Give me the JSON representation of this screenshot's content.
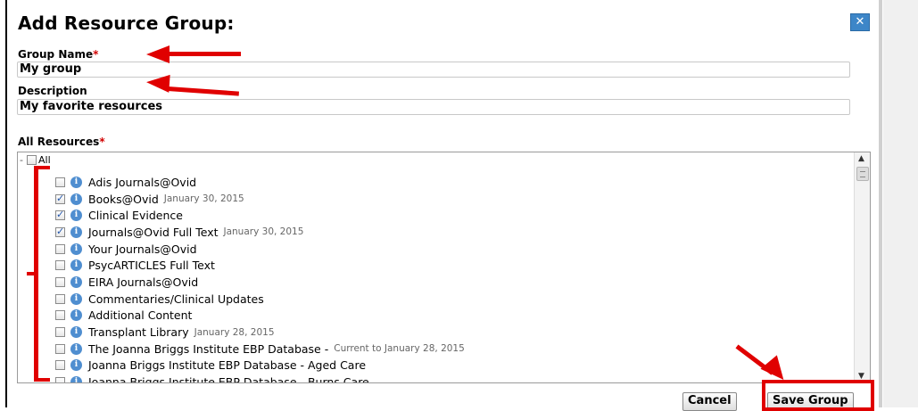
{
  "dialog": {
    "title": "Add Resource Group:",
    "close_glyph": "✕"
  },
  "form": {
    "group_name_label": "Group Name",
    "group_name_value": "My group",
    "description_label": "Description",
    "description_value": "My favorite resources",
    "all_resources_label": "All Resources",
    "required_mark": "*"
  },
  "tree": {
    "root_label": "All",
    "expand_glyph": "-",
    "items": [
      {
        "name": "Adis Journals@Ovid",
        "date": "",
        "checked": false
      },
      {
        "name": "Books@Ovid",
        "date": "January 30, 2015",
        "checked": true
      },
      {
        "name": "Clinical Evidence",
        "date": "",
        "checked": true
      },
      {
        "name": "Journals@Ovid Full Text",
        "date": "January 30, 2015",
        "checked": true
      },
      {
        "name": "Your Journals@Ovid",
        "date": "",
        "checked": false
      },
      {
        "name": "PsycARTICLES Full Text",
        "date": "",
        "checked": false
      },
      {
        "name": "EIRA Journals@Ovid",
        "date": "",
        "checked": false
      },
      {
        "name": "Commentaries/Clinical Updates",
        "date": "",
        "checked": false
      },
      {
        "name": "Additional Content",
        "date": "",
        "checked": false
      },
      {
        "name": "Transplant Library",
        "date": "January 28, 2015",
        "checked": false
      },
      {
        "name": "The Joanna Briggs Institute EBP Database -",
        "date": "Current to January 28, 2015",
        "checked": false
      },
      {
        "name": "Joanna Briggs Institute EBP Database - Aged Care",
        "date": "",
        "checked": false
      },
      {
        "name": "Joanna Briggs Institute EBP Database - Burns Care",
        "date": "",
        "checked": false
      }
    ]
  },
  "buttons": {
    "cancel": "Cancel",
    "save": "Save Group"
  },
  "icons": {
    "info_glyph": "i",
    "scroll_up": "▲",
    "scroll_down": "▼"
  },
  "colors": {
    "annotation_red": "#e00000",
    "info_blue": "#4f8ed0",
    "close_blue": "#3d86c8",
    "required_red": "#d10000"
  }
}
